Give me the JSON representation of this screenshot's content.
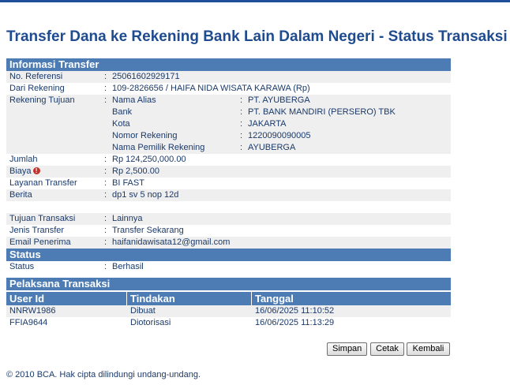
{
  "page_title": "Transfer Dana ke Rekening Bank Lain Dalam Negeri - Status Transaksi",
  "info_section": {
    "title": "Informasi Transfer",
    "no_referensi": {
      "label": "No. Referensi",
      "value": "25061602929171"
    },
    "dari_rekening": {
      "label": "Dari Rekening",
      "value": "109-2826656 / HAIFA NIDA WISATA KARAWA  (Rp)"
    },
    "rekening_tujuan": {
      "label": "Rekening Tujuan",
      "fields": [
        {
          "label": "Nama Alias",
          "value": "PT. AYUBERGA"
        },
        {
          "label": "Bank",
          "value": "PT. BANK MANDIRI (PERSERO) TBK"
        },
        {
          "label": "Kota",
          "value": "JAKARTA"
        },
        {
          "label": "Nomor Rekening",
          "value": "1220090090005"
        },
        {
          "label": "Nama Pemilik Rekening",
          "value": " AYUBERGA"
        }
      ]
    },
    "jumlah": {
      "label": "Jumlah",
      "value": "Rp 124,250,000.00"
    },
    "biaya": {
      "label": "Biaya",
      "icon": "info-icon",
      "value": "Rp 2,500.00"
    },
    "layanan_transfer": {
      "label": "Layanan Transfer",
      "value": "BI FAST"
    },
    "berita": {
      "label": "Berita",
      "value": "dp1 sv 5 nop 12d"
    },
    "tujuan_transaksi": {
      "label": "Tujuan Transaksi",
      "value": " Lainnya"
    },
    "jenis_transfer": {
      "label": "Jenis Transfer",
      "value": "Transfer Sekarang"
    },
    "email_penerima": {
      "label": "Email Penerima",
      "value": "haifanidawisata12@gmail.com"
    }
  },
  "status_section": {
    "title": "Status",
    "status": {
      "label": "Status",
      "value": " Berhasil"
    }
  },
  "pelaksana_section": {
    "title": "Pelaksana Transaksi",
    "columns": [
      "User Id",
      "Tindakan",
      "Tanggal"
    ],
    "rows": [
      [
        "NNRW1986",
        "Dibuat",
        "16/06/2025 11:10:52"
      ],
      [
        "FFIA9644",
        "Diotorisasi",
        "16/06/2025 11:13:29"
      ]
    ]
  },
  "buttons": {
    "simpan": "Simpan",
    "cetak": "Cetak",
    "kembali": "Kembali"
  },
  "colon": ":",
  "footer": "©  2010 BCA. Hak cipta dilindungi undang-undang."
}
